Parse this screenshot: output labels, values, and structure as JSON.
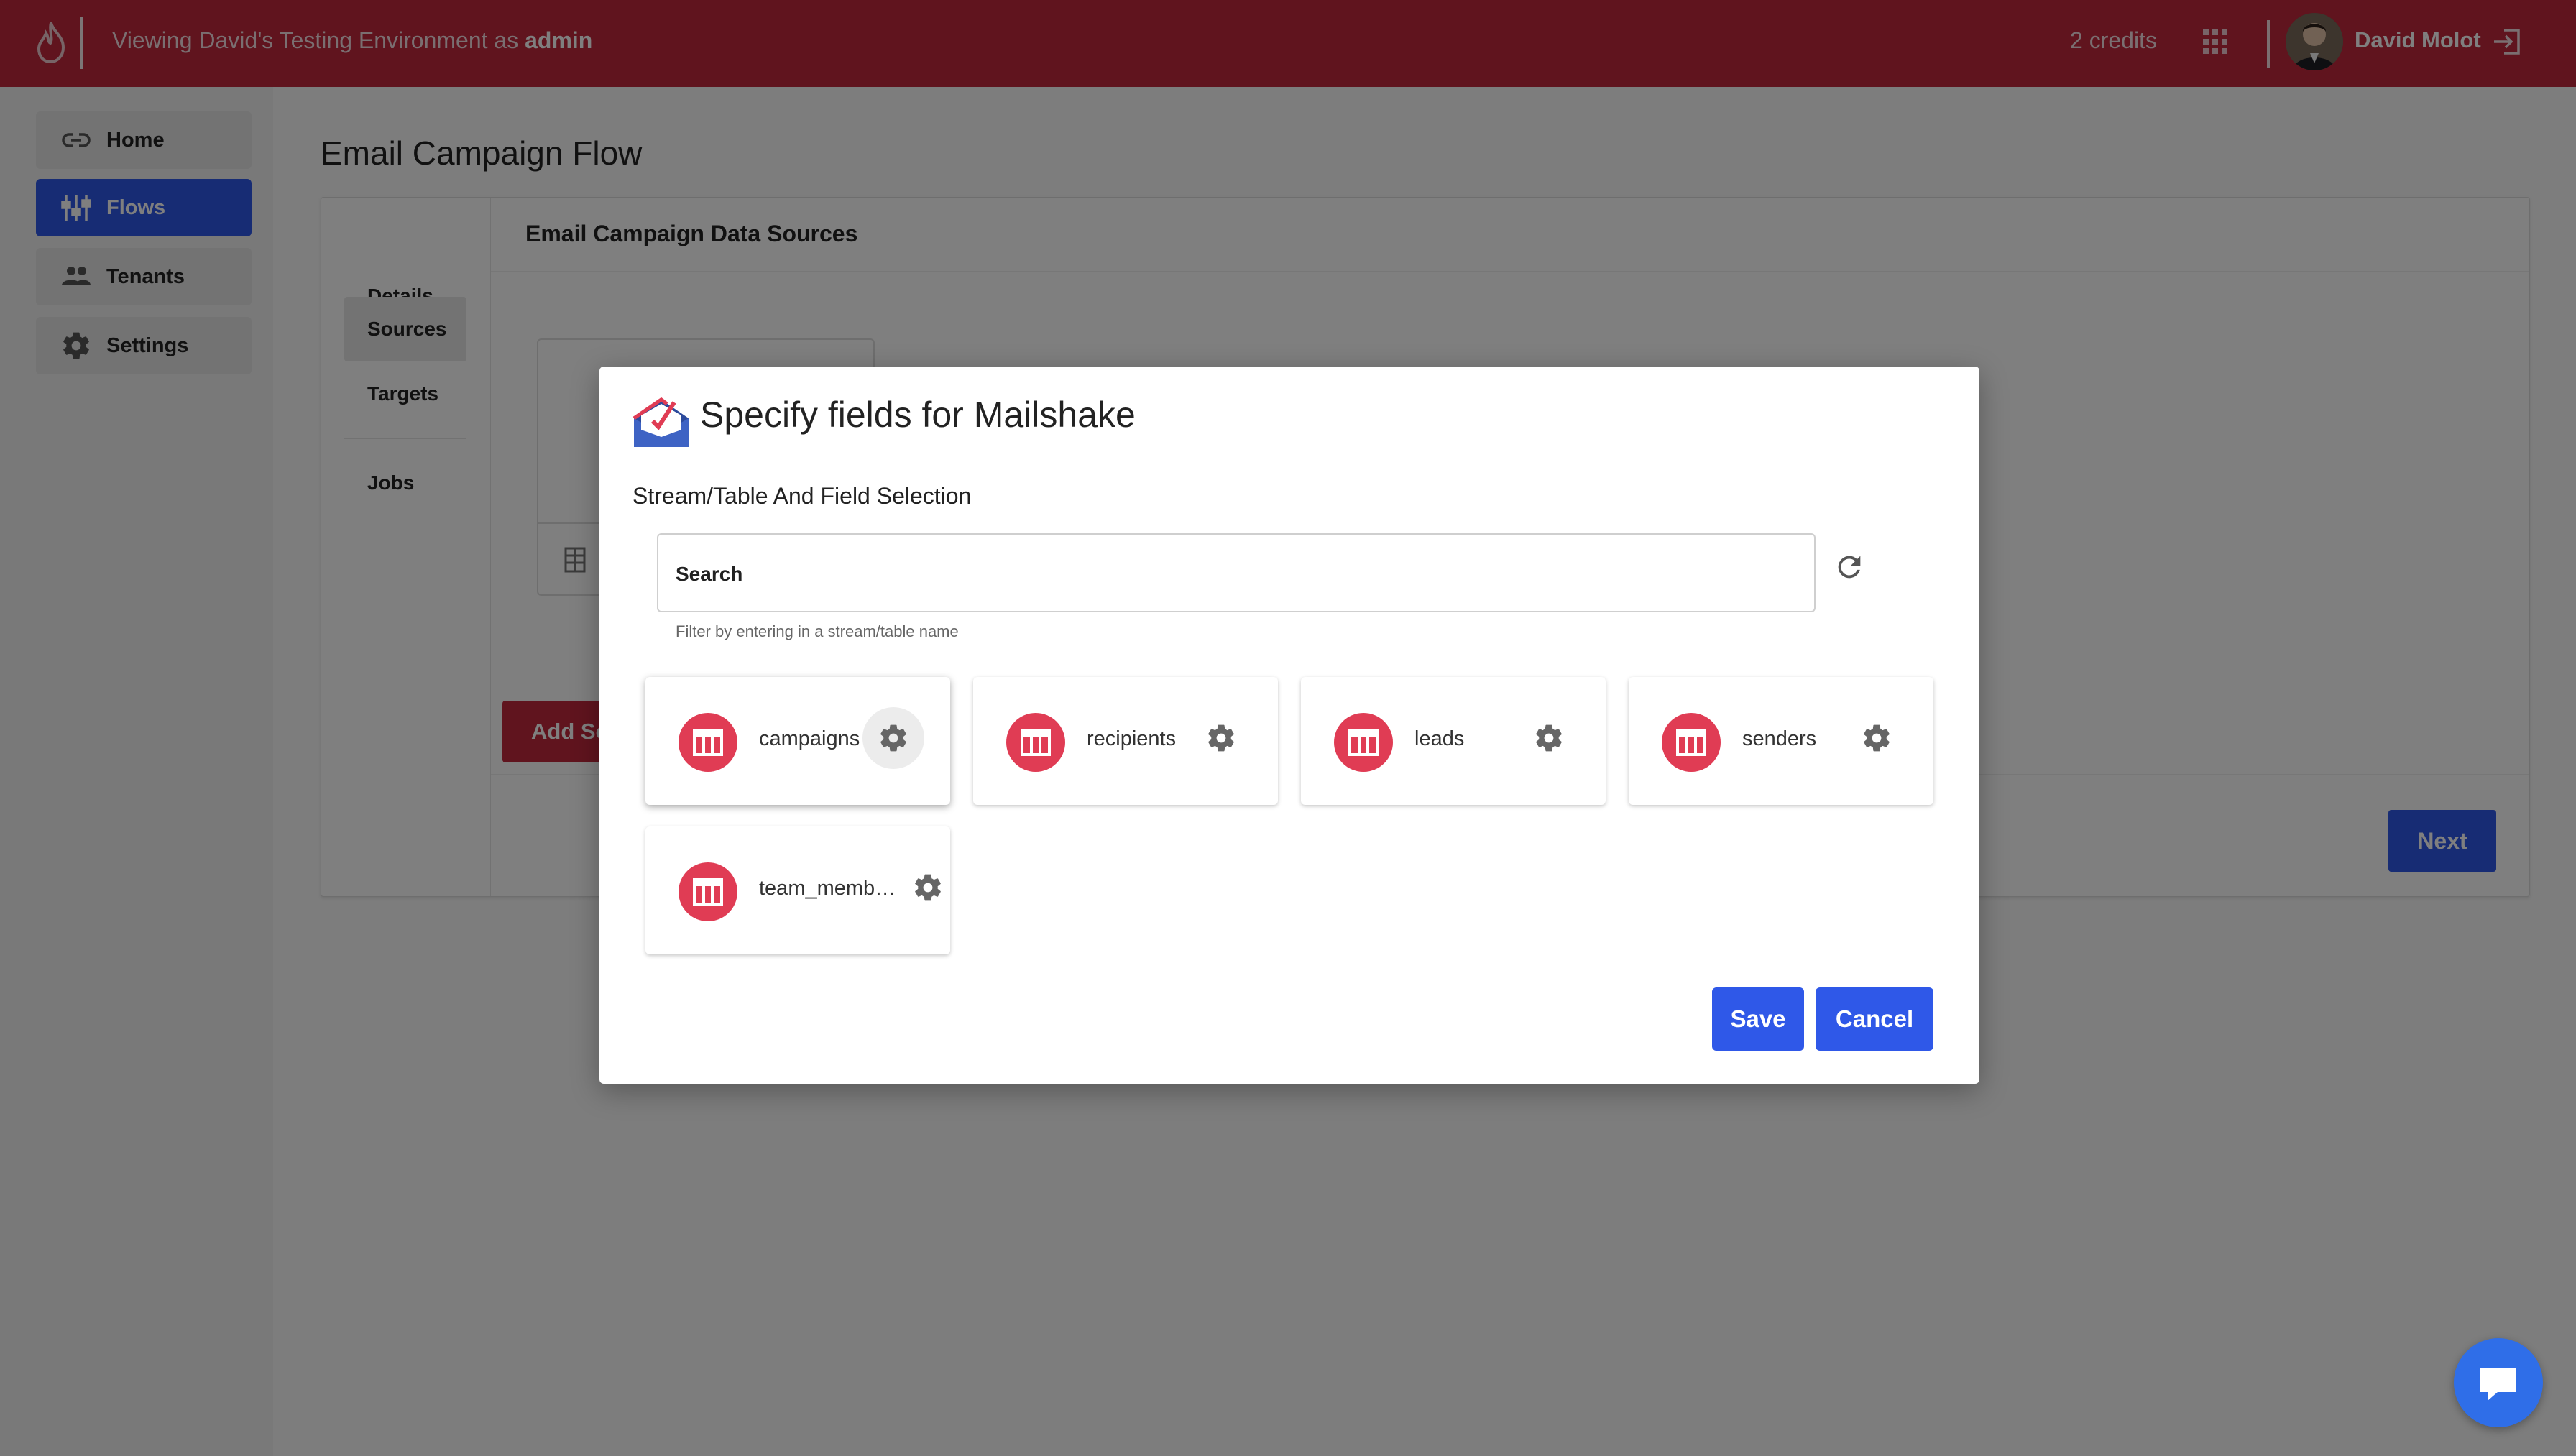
{
  "topbar": {
    "viewing_prefix": "Viewing David's Testing Environment as",
    "role": "admin",
    "credits": "2 credits",
    "user_name": "David Molot"
  },
  "sidebar": {
    "items": [
      {
        "label": "Home",
        "icon": "link-icon"
      },
      {
        "label": "Flows",
        "icon": "flows-icon",
        "active": true
      },
      {
        "label": "Tenants",
        "icon": "people-icon"
      },
      {
        "label": "Settings",
        "icon": "gear-icon"
      }
    ]
  },
  "main": {
    "title": "Email Campaign Flow",
    "subnav": [
      "Details",
      "Sources",
      "Targets",
      "Jobs"
    ],
    "section_title": "Email Campaign Data Sources",
    "add_source_label": "Add Source",
    "next_label": "Next"
  },
  "modal": {
    "title": "Specify fields for Mailshake",
    "subtitle": "Stream/Table And Field Selection",
    "search_placeholder": "Search",
    "helper": "Filter by entering in a stream/table name",
    "streams": [
      "campaigns",
      "recipients",
      "leads",
      "senders",
      "team_members"
    ],
    "save_label": "Save",
    "cancel_label": "Cancel"
  },
  "colors": {
    "brand_red": "#c0283d",
    "accent_blue": "#2f58e8",
    "tile_icon_red": "#e03c54"
  }
}
